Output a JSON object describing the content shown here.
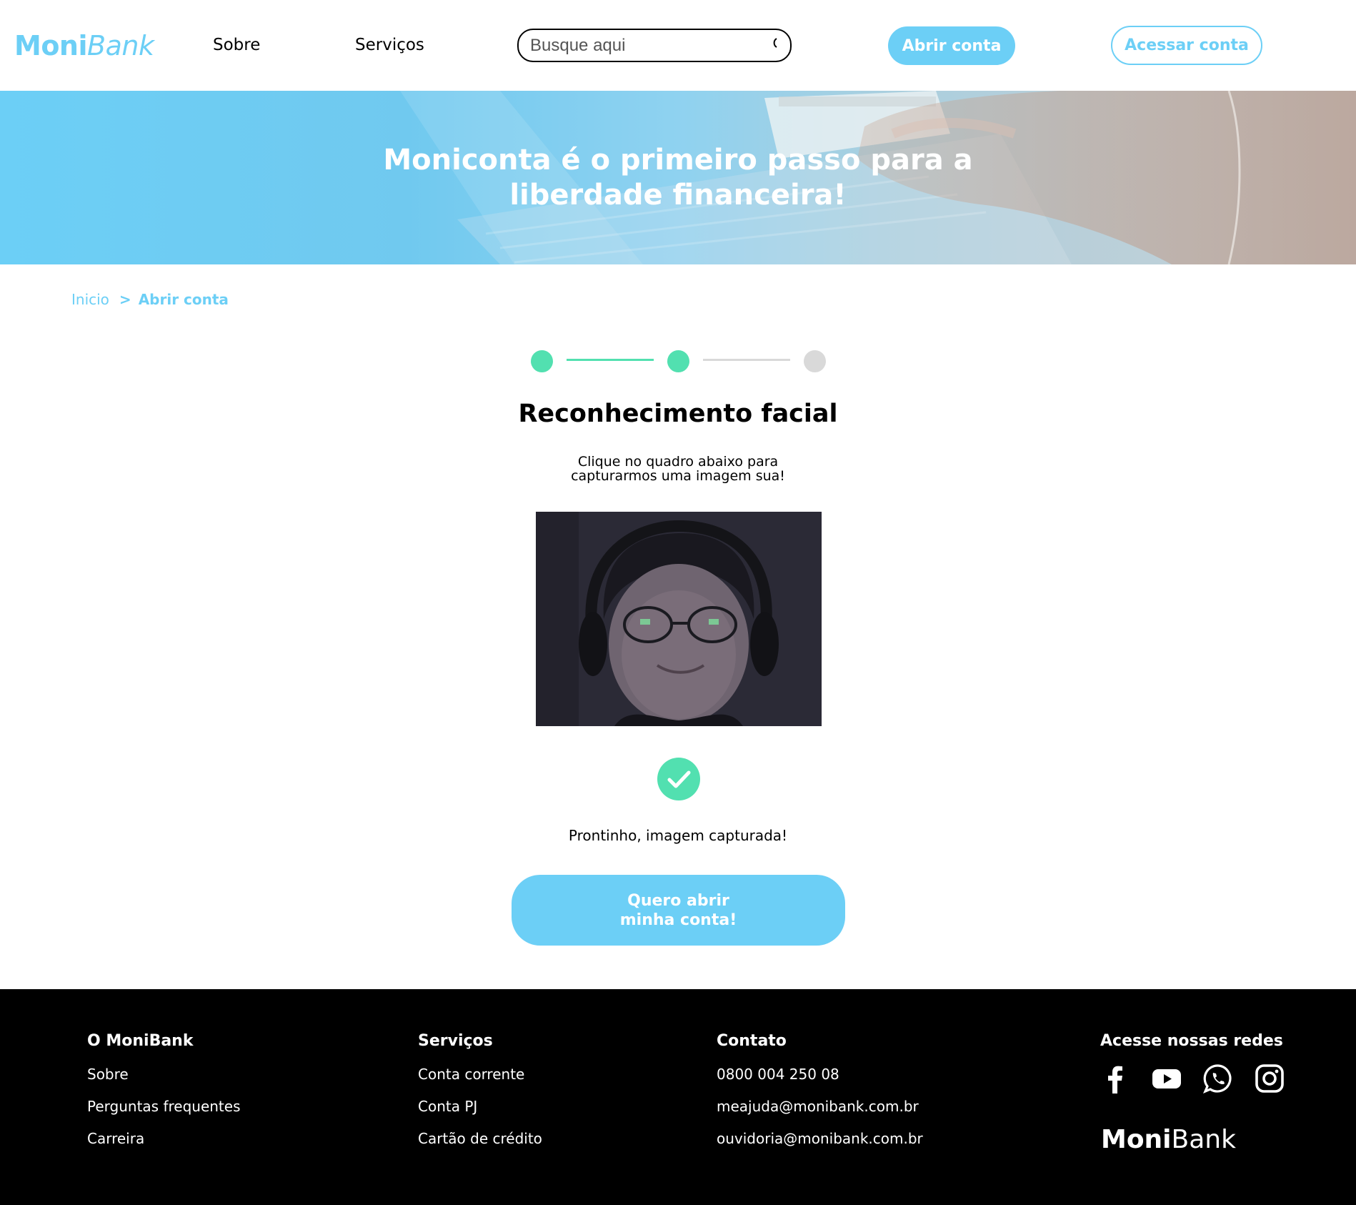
{
  "brand": {
    "name_bold": "Moni",
    "name_light": "Bank",
    "color": "#6ccff6"
  },
  "header": {
    "nav": [
      {
        "label": "Sobre"
      },
      {
        "label": "Serviços"
      }
    ],
    "search": {
      "placeholder": "Busque aqui",
      "icon": "search-icon"
    },
    "open_account_label": "Abrir conta",
    "access_account_label": "Acessar conta"
  },
  "banner": {
    "title": "Moniconta é o primeiro passo para a liberdade financeira!"
  },
  "breadcrumb": {
    "home": "Inicio",
    "separator": ">",
    "current": "Abrir conta"
  },
  "stepper": {
    "steps_total": 3,
    "steps_completed": 2,
    "active_color": "#52e0b0",
    "inactive_color": "#d9d9d9"
  },
  "main": {
    "title": "Reconhecimento facial",
    "instructions": "Clique no quadro abaixo para capturarmos uma imagem sua!",
    "status_icon": "check-circle-icon",
    "status_text": "Prontinho, imagem capturada!",
    "submit_label": "Quero abrir minha conta!"
  },
  "footer": {
    "columns": [
      {
        "heading": "O MoniBank",
        "links": [
          "Sobre",
          "Perguntas frequentes",
          "Carreira"
        ]
      },
      {
        "heading": "Serviços",
        "links": [
          "Conta corrente",
          "Conta PJ",
          "Cartão de crédito"
        ]
      },
      {
        "heading": "Contato",
        "links": [
          "0800 004 250 08",
          "meajuda@monibank.com.br",
          "ouvidoria@monibank.com.br"
        ]
      }
    ],
    "social_heading": "Acesse nossas redes",
    "social_icons": [
      "facebook-icon",
      "youtube-icon",
      "whatsapp-icon",
      "instagram-icon"
    ],
    "brand_bold": "Moni",
    "brand_light": "Bank"
  }
}
